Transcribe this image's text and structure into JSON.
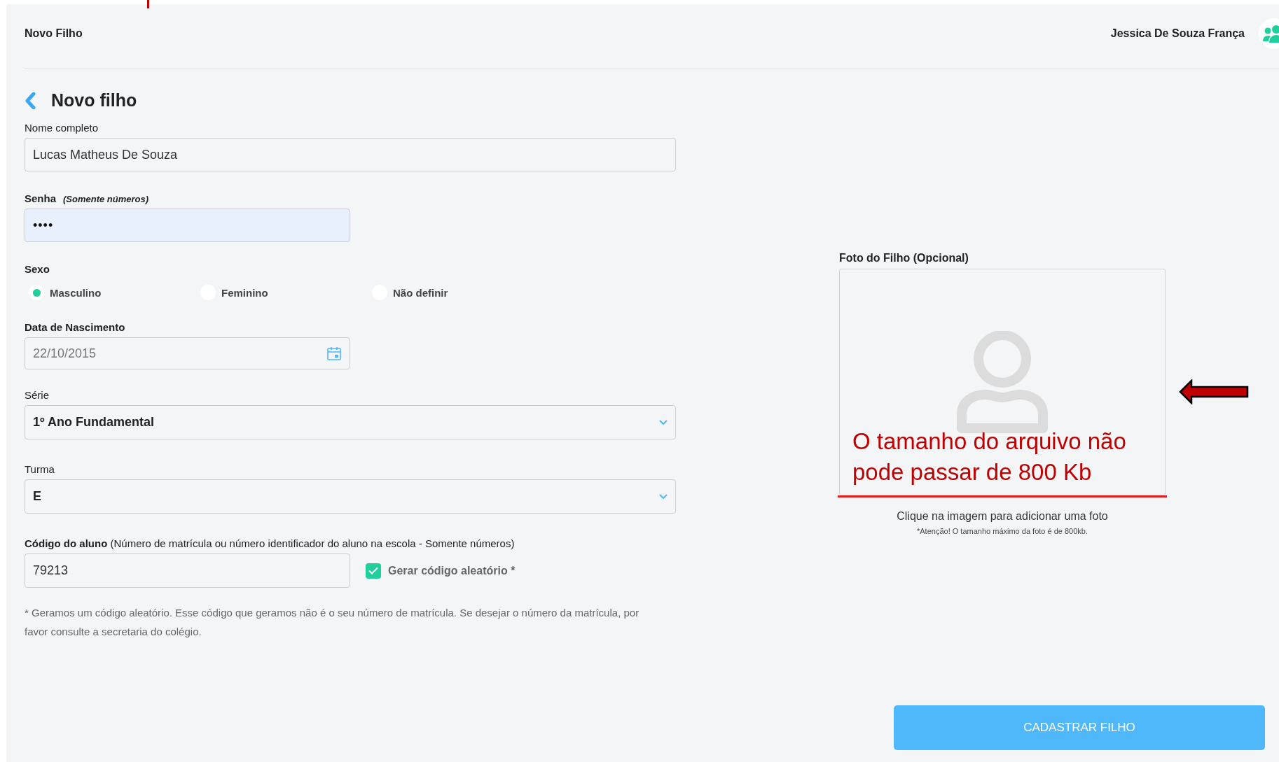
{
  "header": {
    "title": "Novo Filho",
    "user_name": "Jessica De Souza França"
  },
  "page_title": "Novo filho",
  "name_field": {
    "label": "Nome completo",
    "value": "Lucas Matheus De Souza"
  },
  "password_field": {
    "label": "Senha",
    "hint": "(Somente números)",
    "value": "••••"
  },
  "sex": {
    "label": "Sexo",
    "options": [
      {
        "label": "Masculino",
        "selected": true
      },
      {
        "label": "Feminino",
        "selected": false
      },
      {
        "label": "Não definir",
        "selected": false
      }
    ]
  },
  "birth_date": {
    "label": "Data de Nascimento",
    "value": "22/10/2015"
  },
  "series": {
    "label": "Série",
    "value": "1º Ano Fundamental"
  },
  "class_group": {
    "label": "Turma",
    "value": "E"
  },
  "student_code": {
    "label": "Código do aluno",
    "note": "(Número de matrícula ou número identificador do aluno na escola - Somente números)",
    "value": "79213",
    "random_code": {
      "label": "Gerar código aleatório *",
      "checked": true
    }
  },
  "footnote": "* Geramos um código aleatório. Esse código que geramos não é o seu número de matrícula. Se desejar o número da matrícula, por favor consulte a secretaria do colégio.",
  "photo": {
    "label": "Foto do Filho (Opcional)",
    "annotation": "O tamanho do arquivo não pode passar de 800 Kb",
    "caption": "Clique na imagem para adicionar uma foto",
    "note": "*Atenção! O tamanho máximo da foto é de 800kb."
  },
  "submit_button": "CADASTRAR FILHO"
}
